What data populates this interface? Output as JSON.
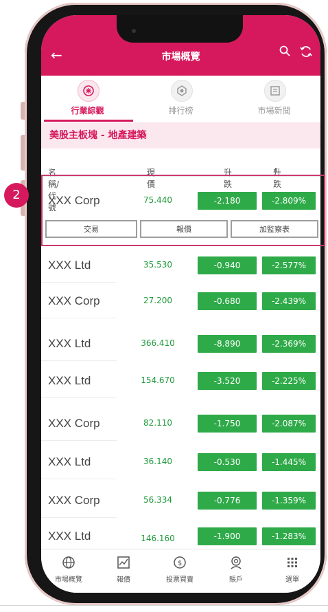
{
  "marker_number": "2",
  "header": {
    "title": "市場概覽"
  },
  "tabs": [
    {
      "label": "行業綜觀",
      "active": true
    },
    {
      "label": "排行榜",
      "active": false
    },
    {
      "label": "市場新聞",
      "active": false
    }
  ],
  "section_title": "美股主板塊 - 地產建築",
  "columns": {
    "name": "名稱/代號",
    "price": "現價",
    "change": "升跌",
    "pct": "升跌幅"
  },
  "actions": {
    "trade": "交易",
    "quote": "報價",
    "watchlist": "加監察表"
  },
  "rows": [
    {
      "name": "XXX Corp",
      "price": "75.440",
      "change": "-2.180",
      "pct": "-2.809%"
    },
    {
      "name": "XXX Ltd",
      "price": "35.530",
      "change": "-0.940",
      "pct": "-2.577%"
    },
    {
      "name": "XXX Corp",
      "price": "27.200",
      "change": "-0.680",
      "pct": "-2.439%"
    },
    {
      "name": "XXX Ltd",
      "price": "366.410",
      "change": "-8.890",
      "pct": "-2.369%"
    },
    {
      "name": "XXX Ltd",
      "price": "154.670",
      "change": "-3.520",
      "pct": "-2.225%"
    },
    {
      "name": "XXX Corp",
      "price": "82.110",
      "change": "-1.750",
      "pct": "-2.087%"
    },
    {
      "name": "XXX Ltd",
      "price": "36.140",
      "change": "-0.530",
      "pct": "-1.445%"
    },
    {
      "name": "XXX Corp",
      "price": "56.334",
      "change": "-0.776",
      "pct": "-1.359%"
    },
    {
      "name": "XXX Ltd",
      "price": "146.160",
      "change": "-1.900",
      "pct": "-1.283%"
    }
  ],
  "bottom_nav": [
    {
      "label": "市場概覽",
      "icon": "globe-icon"
    },
    {
      "label": "報價",
      "icon": "chart-icon"
    },
    {
      "label": "投票買賣",
      "icon": "dollar-icon"
    },
    {
      "label": "賬戶",
      "icon": "account-icon"
    },
    {
      "label": "選單",
      "icon": "grid-icon"
    }
  ],
  "colors": {
    "brand": "#d6195c",
    "down": "#2eaa48"
  }
}
